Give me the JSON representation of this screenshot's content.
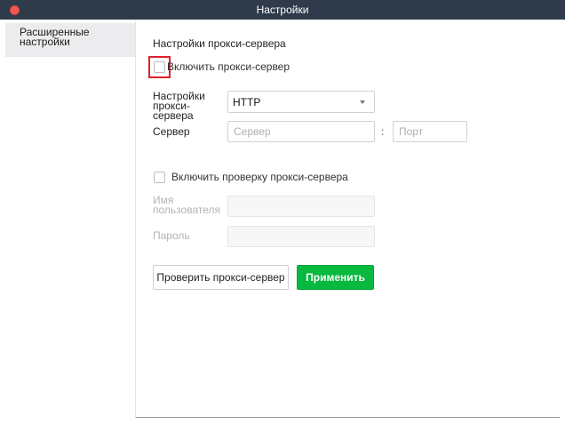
{
  "window": {
    "title": "Настройки"
  },
  "sidebar": {
    "items": [
      {
        "label": "Расширенные настройки",
        "selected": true
      }
    ]
  },
  "proxy": {
    "section_title": "Настройки прокси-сервера",
    "enable_label": "Включить прокси-сервер",
    "enable_checked": false,
    "type_label": "Настройки прокси-сервера",
    "type_value": "HTTP",
    "server_label": "Сервер",
    "server_placeholder": "Сервер",
    "port_separator": ":",
    "port_placeholder": "Порт"
  },
  "auth": {
    "enable_label": "Включить проверку прокси-сервера",
    "enable_checked": false,
    "username_label": "Имя пользователя",
    "password_label": "Пароль"
  },
  "actions": {
    "test_label": "Проверить прокси-сервер",
    "apply_label": "Применить"
  },
  "colors": {
    "titlebar": "#2f3a4a",
    "close_button": "#ee5a52",
    "apply_button": "#09b83e",
    "highlight": "#e0202a"
  }
}
